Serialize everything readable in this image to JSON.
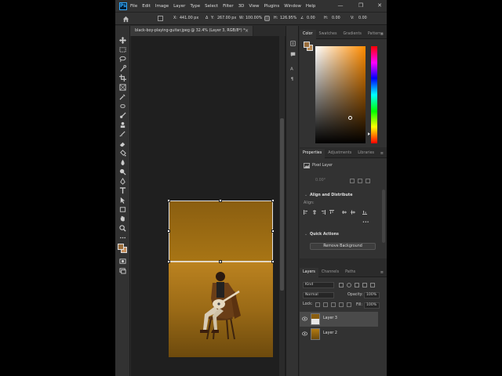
{
  "menu": {
    "items": [
      "File",
      "Edit",
      "Image",
      "Layer",
      "Type",
      "Select",
      "Filter",
      "3D",
      "View",
      "Plugins",
      "Window",
      "Help"
    ]
  },
  "window_controls": {
    "minimize": "—",
    "restore": "❐",
    "close": "✕"
  },
  "options_bar": {
    "x_label": "X:",
    "x_value": "441.00 px",
    "y_label": "Y:",
    "y_value": "267.00 px",
    "w_label": "W:",
    "w_value": "100.00%",
    "h_label": "H:",
    "h_value": "126.95%",
    "angle_value": "0.00",
    "hskew_label": "H:",
    "hskew_value": "0.00",
    "vskew_label": "V:",
    "vskew_value": "0.00"
  },
  "document": {
    "tab_title": "black-boy-playing-guitar.jpeg @ 32.4% (Layer 3, RGB/8*) *",
    "close_glyph": "×"
  },
  "color_panel": {
    "tabs": [
      "Color",
      "Swatches",
      "Gradients",
      "Patterns"
    ],
    "active_tab": "Color",
    "foreground_color": "#9a6d3b",
    "background_color": "#b5864f"
  },
  "properties_panel": {
    "tabs": [
      "Properties",
      "Adjustments",
      "Libraries"
    ],
    "active_tab": "Properties",
    "layer_type": "Pixel Layer",
    "w_value": "0.00°",
    "align_section": "Align and Distribute",
    "align_label": "Align:",
    "quick_actions_section": "Quick Actions",
    "remove_bg_button": "Remove Background",
    "more_glyph": "•••"
  },
  "layers_panel": {
    "tabs": [
      "Layers",
      "Channels",
      "Paths"
    ],
    "active_tab": "Layers",
    "kind_placeholder": "Kind",
    "blend_mode": "Normal",
    "opacity_label": "Opacity:",
    "opacity_value": "100%",
    "lock_label": "Lock:",
    "fill_label": "Fill:",
    "fill_value": "100%",
    "layers": [
      {
        "name": "Layer 3",
        "visible": true,
        "selected": true
      },
      {
        "name": "Layer 2",
        "visible": true,
        "selected": false
      }
    ]
  },
  "colors": {
    "app_bg": "#2b2b2b",
    "panel_bg": "#323232",
    "canvas_bg": "#1f1f1f",
    "accent": "#31a8ff"
  }
}
